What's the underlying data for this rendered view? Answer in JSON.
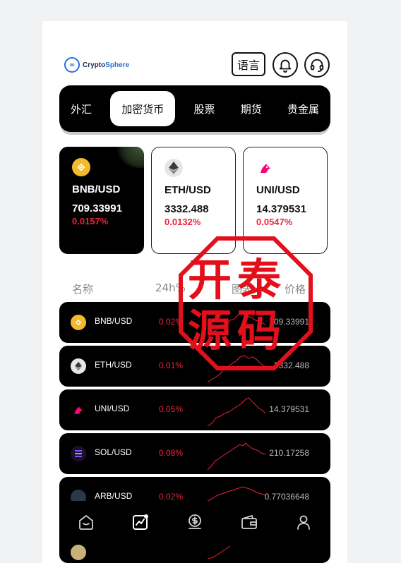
{
  "header": {
    "logo_text_main": "Crypto",
    "logo_text_accent": "Sphere",
    "lang_label": "语言"
  },
  "tabs": [
    {
      "label": "外汇",
      "active": false
    },
    {
      "label": "加密货币",
      "active": true
    },
    {
      "label": "股票",
      "active": false
    },
    {
      "label": "期货",
      "active": false
    },
    {
      "label": "贵金属",
      "active": false
    }
  ],
  "cards": [
    {
      "pair": "BNB/USD",
      "price": "709.33991",
      "change": "0.0157%",
      "icon": "bnb-icon",
      "color": "#f3ba2f"
    },
    {
      "pair": "ETH/USD",
      "price": "3332.488",
      "change": "0.0132%",
      "icon": "eth-icon",
      "color": "#627eea"
    },
    {
      "pair": "UNI/USD",
      "price": "14.379531",
      "change": "0.0547%",
      "icon": "uni-icon",
      "color": "#ff007a"
    }
  ],
  "list_header": {
    "name": "名称",
    "change": "24h%",
    "chart": "图表",
    "price": "价格"
  },
  "rows": [
    {
      "pair": "BNB/USD",
      "change": "0.02%",
      "price": "709.33991",
      "icon": "bnb-icon",
      "color": "#f3ba2f"
    },
    {
      "pair": "ETH/USD",
      "change": "0.01%",
      "price": "3332.488",
      "icon": "eth-icon",
      "color": "#c9c9c9"
    },
    {
      "pair": "UNI/USD",
      "change": "0.05%",
      "price": "14.379531",
      "icon": "uni-icon",
      "color": "#ff007a"
    },
    {
      "pair": "SOL/USD",
      "change": "0.08%",
      "price": "210.17258",
      "icon": "sol-icon",
      "color": "#9945ff"
    },
    {
      "pair": "ARB/USD",
      "change": "0.02%",
      "price": "0.77036648",
      "icon": "arb-icon",
      "color": "#28a0f0"
    }
  ],
  "stamp": {
    "line1": "开泰",
    "line2": "源码"
  },
  "colors": {
    "negative": "#e8243c",
    "sparkline": "#e8243c",
    "tab_bg": "#000000"
  }
}
